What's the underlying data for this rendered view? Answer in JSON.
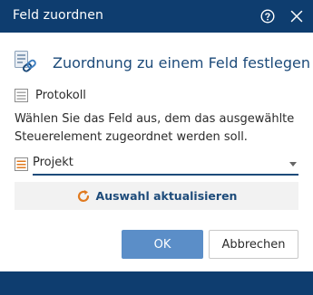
{
  "window": {
    "title": "Feld zuordnen",
    "help_icon": "help-circle-icon",
    "close_icon": "close-icon"
  },
  "dialog": {
    "heading": "Zuordnung zu einem Feld festlegen",
    "heading_icon": "link-assign-icon",
    "field_label": "Protokoll",
    "field_icon": "form-field-icon",
    "description": "Wählen Sie das Feld aus, dem das ausgewählte Steuerelement zugeordnet werden soll.",
    "select": {
      "value": "Projekt",
      "icon": "form-field-highlighted-icon"
    },
    "refresh_label": "Auswahl aktualisieren",
    "refresh_icon": "refresh-icon"
  },
  "buttons": {
    "ok": "OK",
    "cancel": "Abbrechen"
  },
  "colors": {
    "titlebar": "#0e3d6f",
    "primary_button": "#5b8ec8",
    "accent_text": "#1d4b7a",
    "refresh_icon": "#e07a1f"
  }
}
